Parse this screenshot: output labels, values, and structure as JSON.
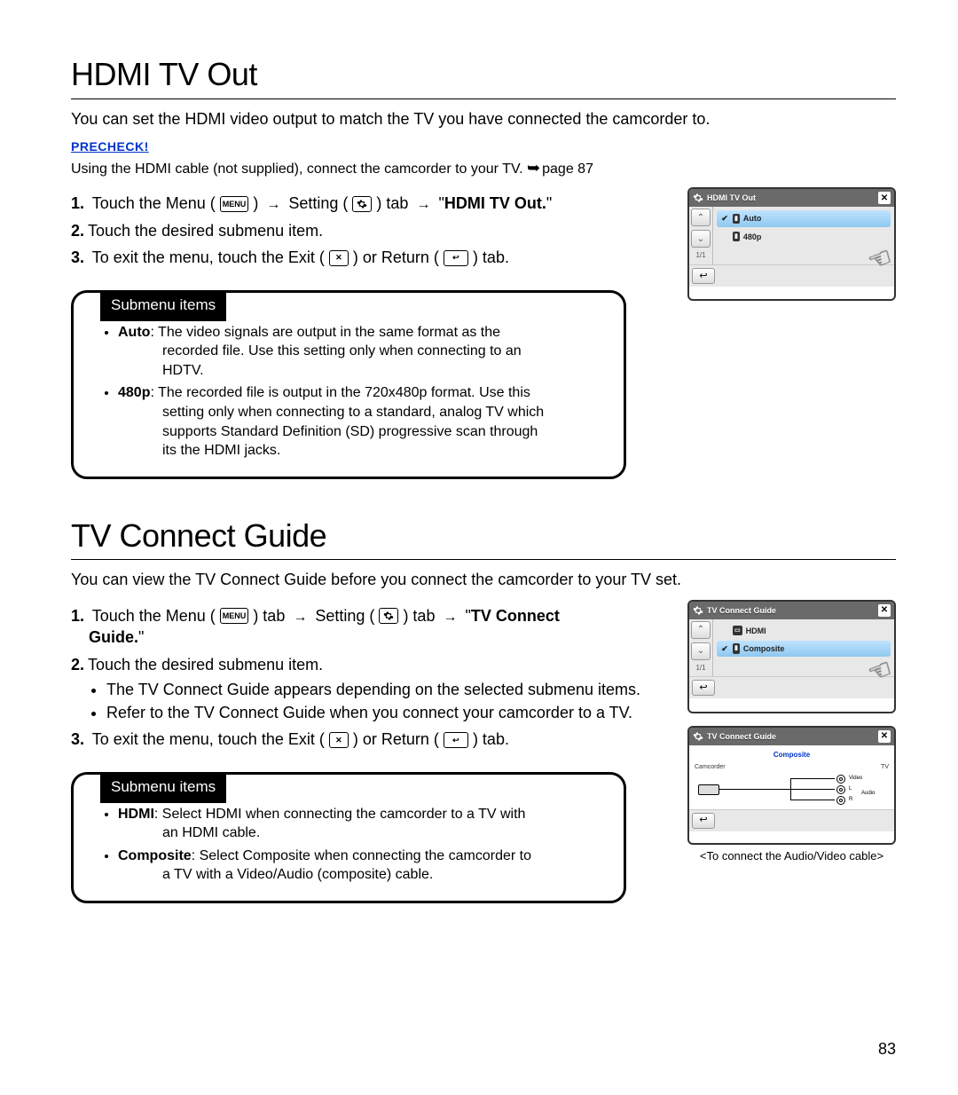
{
  "page_number": "83",
  "section1": {
    "title": "HDMI TV Out",
    "intro": "You can set the HDMI video output to match the TV you have connected the camcorder to.",
    "precheck_label": "PRECHECK!",
    "precheck_text_a": "Using the HDMI cable (not supplied), connect the camcorder to your TV. ",
    "precheck_page_ref": "page 87",
    "steps": {
      "s1a": "Touch the Menu (",
      "s1b": ") ",
      "s1c": " Setting (",
      "s1d": ") tab ",
      "s1e": " \"",
      "s1f": "HDMI TV Out.",
      "s1g": "\"",
      "s2": "Touch the desired submenu item.",
      "s3a": "To exit the menu, touch the Exit (",
      "s3b": ") or Return (",
      "s3c": ") tab."
    },
    "submenu_label": "Submenu items",
    "items": {
      "auto_term": "Auto",
      "auto_desc": "The video signals are output in the same format as the recorded file. Use this setting only when connecting to an HDTV.",
      "p480_term": "480p",
      "p480_desc": "The recorded file is output in the 720x480p format. Use this setting only when connecting to a standard, analog TV which supports Standard Definition (SD) progressive scan through its the HDMI jacks."
    },
    "screen": {
      "title": "HDMI TV Out",
      "opt1": "Auto",
      "opt2": "480p",
      "page": "1/1"
    }
  },
  "section2": {
    "title": "TV Connect Guide",
    "intro": "You can view the TV Connect Guide before you connect the camcorder to your TV set.",
    "steps": {
      "s1a": "Touch the Menu (",
      "s1b": ") tab ",
      "s1c": " Setting (",
      "s1d": ") tab ",
      "s1e": " \"",
      "s1f": "TV Connect Guide.",
      "s1g": "\"",
      "s2": "Touch the desired submenu item.",
      "s2b1": "The TV Connect Guide appears depending on the selected submenu items.",
      "s2b2": "Refer to the TV Connect Guide when you connect your camcorder to a TV.",
      "s3a": "To exit the menu, touch the Exit (",
      "s3b": ") or Return (",
      "s3c": ") tab."
    },
    "submenu_label": "Submenu items",
    "items": {
      "hdmi_term": "HDMI",
      "hdmi_desc": "Select HDMI when connecting the camcorder to a TV with an HDMI cable.",
      "comp_term": "Composite",
      "comp_desc": "Select Composite when connecting the camcorder to a TV with a Video/Audio (composite) cable."
    },
    "screen1": {
      "title": "TV Connect Guide",
      "opt1": "HDMI",
      "opt2": "Composite",
      "page": "1/1"
    },
    "screen2": {
      "title": "TV Connect Guide",
      "subtitle": "Composite",
      "left": "Camcorder",
      "right": "TV",
      "video": "Video",
      "l": "L",
      "r": "R",
      "audio": "Audio"
    },
    "caption": "<To connect the Audio/Video cable>"
  },
  "icons": {
    "menu": "MENU"
  }
}
